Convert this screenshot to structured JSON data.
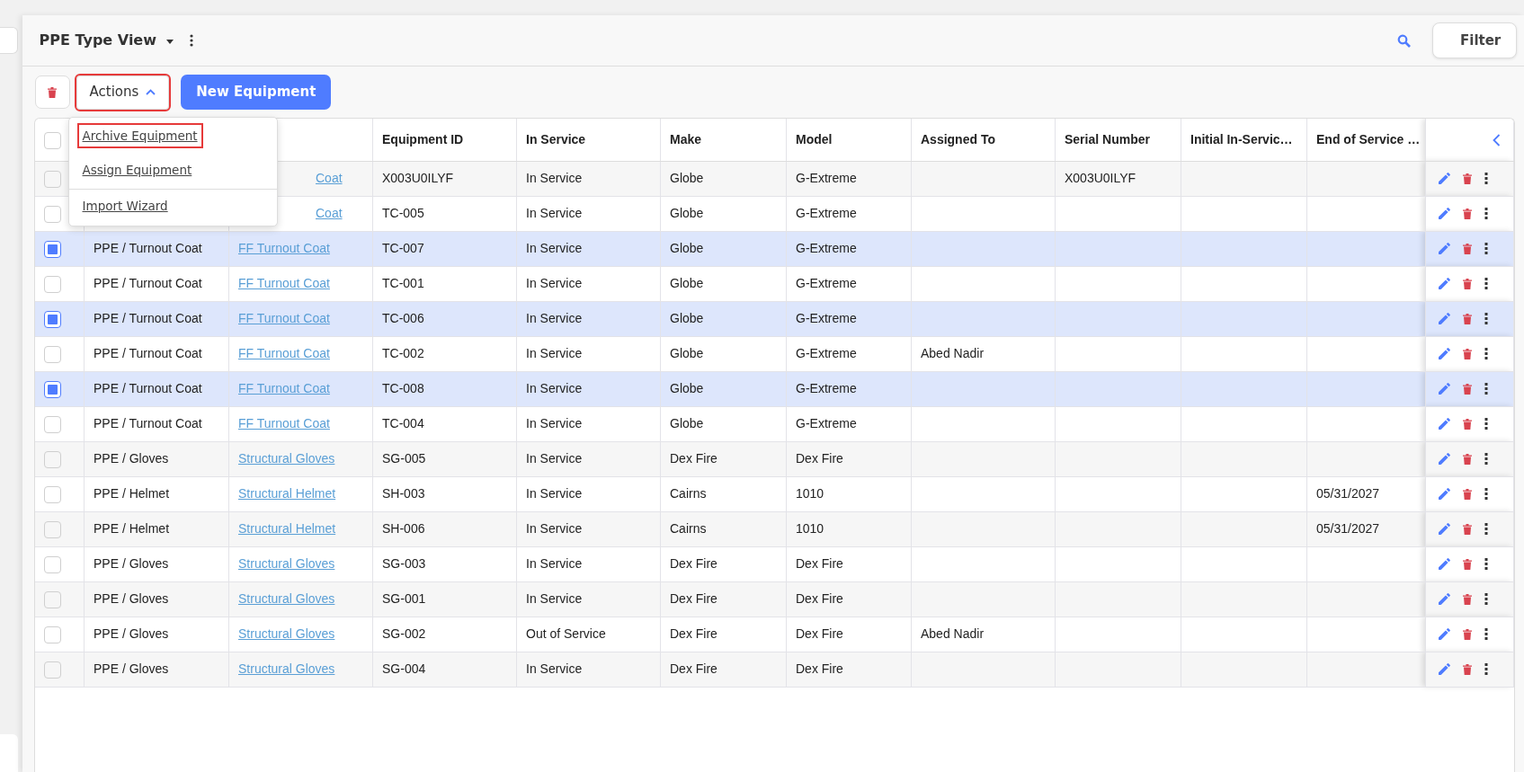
{
  "view": {
    "title": "PPE Type View"
  },
  "filter_button": {
    "label": "Filter"
  },
  "actions_button": {
    "label": "Actions",
    "expanded": true,
    "highlighted": true
  },
  "new_button": {
    "label": "New Equipment"
  },
  "actions_menu": [
    {
      "label": "Archive Equipment",
      "highlighted": true,
      "divider_before": false
    },
    {
      "label": "Assign Equipment",
      "highlighted": false,
      "divider_before": false
    },
    {
      "label": "Import Wizard",
      "highlighted": false,
      "divider_before": true
    }
  ],
  "table": {
    "all_selected": false,
    "columns": [
      "Equipment ID",
      "In Service",
      "Make",
      "Model",
      "Assigned To",
      "Serial Number",
      "Initial In-Servic…",
      "End of Service …"
    ],
    "rows": [
      {
        "selected": false,
        "item": "Coat",
        "item_cut": true,
        "equipment_id": "X003U0ILYF",
        "in_service": "In Service",
        "make": "Globe",
        "model": "G-Extreme",
        "serial_number": "X003U0ILYF"
      },
      {
        "selected": false,
        "item": "Coat",
        "item_cut": true,
        "equipment_id": "TC-005",
        "in_service": "In Service",
        "make": "Globe",
        "model": "G-Extreme"
      },
      {
        "selected": true,
        "type": "PPE / Turnout Coat",
        "item": "FF Turnout Coat",
        "item_cut": false,
        "equipment_id": "TC-007",
        "in_service": "In Service",
        "make": "Globe",
        "model": "G-Extreme"
      },
      {
        "selected": false,
        "type": "PPE / Turnout Coat",
        "item": "FF Turnout Coat",
        "item_cut": false,
        "equipment_id": "TC-001",
        "in_service": "In Service",
        "make": "Globe",
        "model": "G-Extreme"
      },
      {
        "selected": true,
        "type": "PPE / Turnout Coat",
        "item": "FF Turnout Coat",
        "item_cut": false,
        "equipment_id": "TC-006",
        "in_service": "In Service",
        "make": "Globe",
        "model": "G-Extreme"
      },
      {
        "selected": false,
        "type": "PPE / Turnout Coat",
        "item": "FF Turnout Coat",
        "item_cut": false,
        "equipment_id": "TC-002",
        "in_service": "In Service",
        "make": "Globe",
        "model": "G-Extreme",
        "assigned_to": "Abed Nadir"
      },
      {
        "selected": true,
        "type": "PPE / Turnout Coat",
        "item": "FF Turnout Coat",
        "item_cut": false,
        "equipment_id": "TC-008",
        "in_service": "In Service",
        "make": "Globe",
        "model": "G-Extreme"
      },
      {
        "selected": false,
        "type": "PPE / Turnout Coat",
        "item": "FF Turnout Coat",
        "item_cut": false,
        "equipment_id": "TC-004",
        "in_service": "In Service",
        "make": "Globe",
        "model": "G-Extreme"
      },
      {
        "selected": false,
        "type": "PPE / Gloves",
        "item": "Structural Gloves",
        "item_cut": false,
        "equipment_id": "SG-005",
        "in_service": "In Service",
        "make": "Dex Fire",
        "model": "Dex Fire"
      },
      {
        "selected": false,
        "type": "PPE / Helmet",
        "item": "Structural Helmet",
        "item_cut": false,
        "equipment_id": "SH-003",
        "in_service": "In Service",
        "make": "Cairns",
        "model": "1010",
        "end_of_service": "05/31/2027"
      },
      {
        "selected": false,
        "type": "PPE / Helmet",
        "item": "Structural Helmet",
        "item_cut": false,
        "equipment_id": "SH-006",
        "in_service": "In Service",
        "make": "Cairns",
        "model": "1010",
        "end_of_service": "05/31/2027"
      },
      {
        "selected": false,
        "type": "PPE / Gloves",
        "item": "Structural Gloves",
        "item_cut": false,
        "equipment_id": "SG-003",
        "in_service": "In Service",
        "make": "Dex Fire",
        "model": "Dex Fire"
      },
      {
        "selected": false,
        "type": "PPE / Gloves",
        "item": "Structural Gloves",
        "item_cut": false,
        "equipment_id": "SG-001",
        "in_service": "In Service",
        "make": "Dex Fire",
        "model": "Dex Fire"
      },
      {
        "selected": false,
        "type": "PPE / Gloves",
        "item": "Structural Gloves",
        "item_cut": false,
        "equipment_id": "SG-002",
        "in_service": "Out of Service",
        "make": "Dex Fire",
        "model": "Dex Fire",
        "assigned_to": "Abed Nadir"
      },
      {
        "selected": false,
        "type": "PPE / Gloves",
        "item": "Structural Gloves",
        "item_cut": false,
        "equipment_id": "SG-004",
        "in_service": "In Service",
        "make": "Dex Fire",
        "model": "Dex Fire"
      }
    ]
  }
}
